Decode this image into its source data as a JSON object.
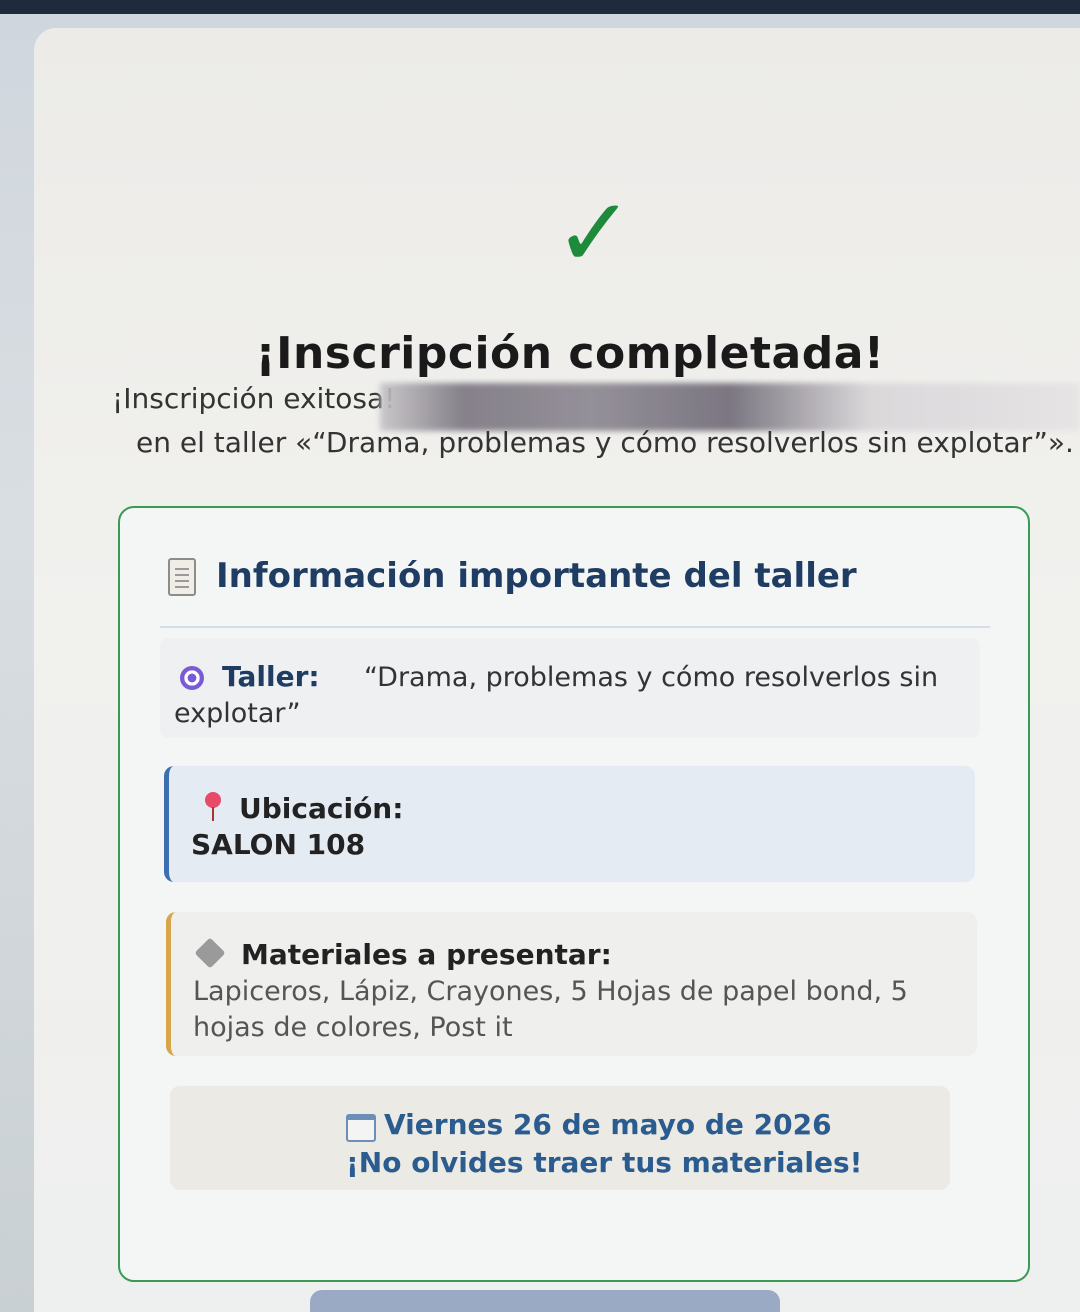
{
  "header": {
    "check_icon": "✓",
    "title": "¡Inscripción completada!"
  },
  "success": {
    "line1": "¡Inscripción exitosa!",
    "line2": "en el taller «“Drama, problemas y cómo resolverlos sin explotar”»."
  },
  "info_card": {
    "title_icon": "clipboard-icon",
    "title": "Información importante del taller",
    "taller": {
      "icon": "target-icon",
      "label": "Taller:",
      "value_part1": "“Drama, problemas y cómo resolverlos sin",
      "value_part2": "explotar”"
    },
    "ubicacion": {
      "icon": "pin-icon",
      "label": "Ubicación:",
      "value": "SALON 108",
      "accent_color": "#3b6fb0"
    },
    "materiales": {
      "icon": "box-icon",
      "label": "Materiales a presentar:",
      "value": "Lapiceros, Lápiz, Crayones, 5 Hojas de papel bond, 5 hojas de colores, Post it",
      "accent_color": "#d7a54a"
    },
    "fecha": {
      "icon": "calendar-icon",
      "date": "Viernes 26 de mayo de 2026",
      "note": "¡No olvides traer tus materiales!"
    }
  },
  "colors": {
    "success_green": "#1e8a3c",
    "card_border": "#3a9a54",
    "heading_blue": "#1f3c63"
  }
}
